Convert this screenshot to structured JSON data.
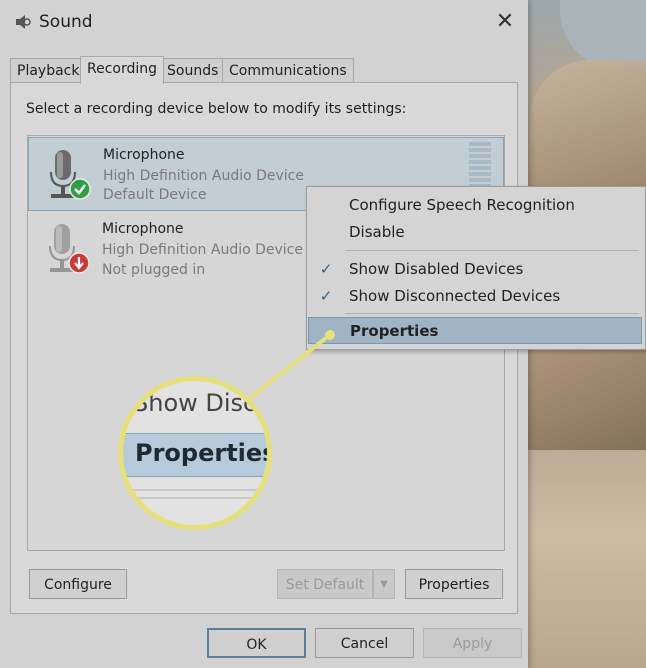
{
  "window": {
    "title": "Sound",
    "close_glyph": "✕",
    "icon": "speaker-icon"
  },
  "tabs": [
    {
      "label": "Playback",
      "active": false
    },
    {
      "label": "Recording",
      "active": true
    },
    {
      "label": "Sounds",
      "active": false
    },
    {
      "label": "Communications",
      "active": false
    }
  ],
  "panel": {
    "instruction": "Select a recording device below to modify its settings:"
  },
  "devices": [
    {
      "name": "Microphone",
      "driver": "High Definition Audio Device",
      "status": "Default Device",
      "selected": true,
      "status_icon": "green-check-icon"
    },
    {
      "name": "Microphone",
      "driver": "High Definition Audio Device",
      "status": "Not plugged in",
      "selected": false,
      "status_icon": "red-down-arrow-icon"
    }
  ],
  "context_menu": {
    "items": [
      {
        "label": "Configure Speech Recognition",
        "checked": false
      },
      {
        "label": "Disable",
        "checked": false
      },
      {
        "label": "Show Disabled Devices",
        "checked": true
      },
      {
        "label": "Show Disconnected Devices",
        "checked": true
      },
      {
        "label": "Properties",
        "checked": false,
        "highlighted": true
      }
    ],
    "check_glyph": "✓"
  },
  "magnifier": {
    "partial_text": "Show Disc",
    "focus_text": "Properties",
    "border_color": "#e5e07a"
  },
  "panel_buttons": {
    "configure": "Configure",
    "set_default": "Set Default",
    "set_default_arrow": "▼",
    "properties": "Properties"
  },
  "dialog_buttons": {
    "ok": "OK",
    "cancel": "Cancel",
    "apply": "Apply"
  },
  "colors": {
    "accent": "#5c7f96",
    "highlight": "#9fb4c4",
    "check_green": "#2f9e44",
    "unplugged_red": "#c93b3b"
  }
}
